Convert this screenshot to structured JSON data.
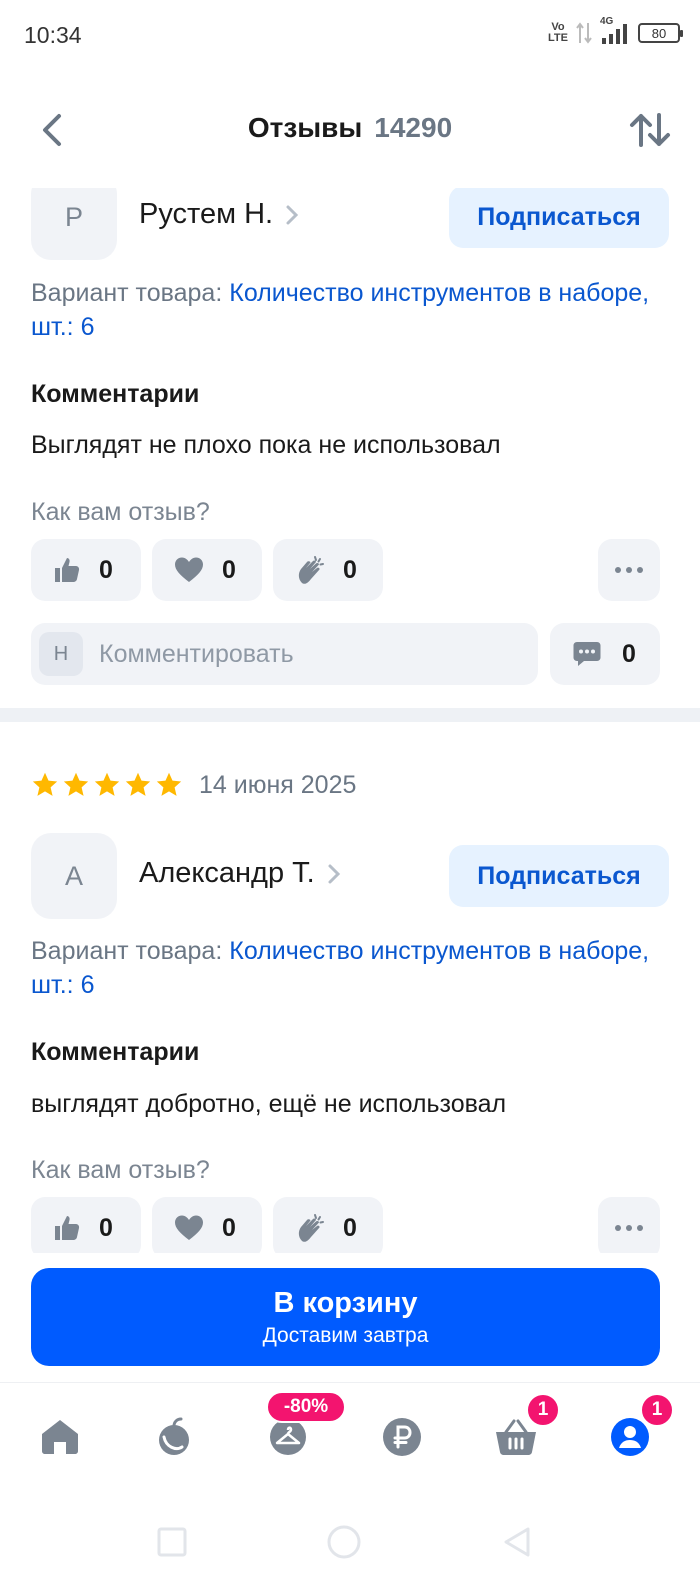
{
  "status_bar": {
    "time": "10:34",
    "volte_top": "Vo",
    "volte_bottom": "LTE",
    "network": "4G",
    "battery": "80"
  },
  "header": {
    "title": "Отзывы",
    "count": "14290"
  },
  "reviews": [
    {
      "avatar_letter": "Р",
      "author": "Рустем Н.",
      "subscribe_label": "Подписаться",
      "variant_label": "Вариант товара:",
      "variant_value": "Количество инструментов в наборе, шт.: 6",
      "comment_label": "Комментарии",
      "comment_text": "Выглядят не плохо пока не использовал",
      "question": "Как вам отзыв?",
      "likes": "0",
      "hearts": "0",
      "claps": "0",
      "comment_avatar_letter": "Н",
      "comment_placeholder": "Комментировать",
      "comments_count": "0"
    },
    {
      "rating": 5,
      "date": "14 июня 2025",
      "avatar_letter": "А",
      "author": "Александр Т.",
      "subscribe_label": "Подписаться",
      "variant_label": "Вариант товара:",
      "variant_value": "Количество инструментов в наборе, шт.: 6",
      "comment_label": "Комментарии",
      "comment_text": "выглядят добротно, ещё не использовал",
      "question": "Как вам отзыв?",
      "likes": "0",
      "hearts": "0",
      "claps": "0"
    }
  ],
  "cta": {
    "label": "В корзину",
    "sublabel": "Доставим завтра"
  },
  "bottom_nav": {
    "items": [
      {
        "icon": "home-icon"
      },
      {
        "icon": "fresh-icon"
      },
      {
        "icon": "clothes-icon",
        "badge": "-80%"
      },
      {
        "icon": "ruble-icon"
      },
      {
        "icon": "cart-icon",
        "badge": "1"
      },
      {
        "icon": "profile-icon",
        "badge": "1"
      }
    ]
  },
  "colors": {
    "accent": "#005bff",
    "link": "#0a57cf",
    "star": "#ffb800",
    "badge": "#f3146f"
  }
}
